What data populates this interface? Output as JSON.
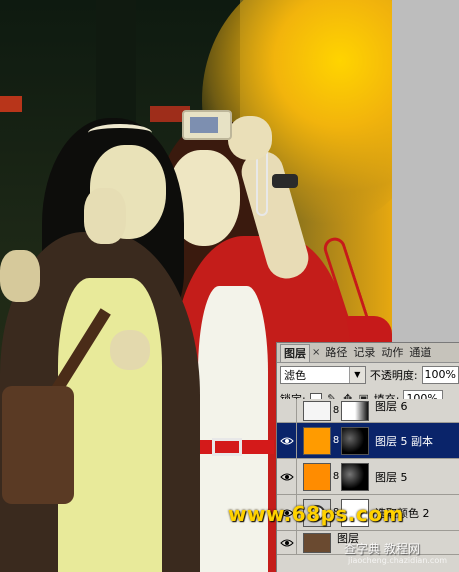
{
  "layers_panel": {
    "tabs": [
      {
        "label": "图层",
        "active": true
      },
      {
        "label": "路径",
        "active": false
      },
      {
        "label": "记录",
        "active": false
      },
      {
        "label": "动作",
        "active": false
      },
      {
        "label": "通道",
        "active": false
      }
    ],
    "tab_close": "×",
    "blend_mode": "滤色",
    "opacity_label": "不透明度:",
    "opacity_value": "100%",
    "lock_label": "锁定:",
    "fill_label": "填充:",
    "fill_value": "100%",
    "layers": [
      {
        "name": "图层 6",
        "visible": false,
        "selected": false,
        "thumb_color": "#f5f5f5",
        "mask": "white-black"
      },
      {
        "name": "图层 5 副本",
        "visible": true,
        "selected": true,
        "thumb_color": "#ff8c00",
        "mask": "black-radial"
      },
      {
        "name": "图层 5",
        "visible": true,
        "selected": false,
        "thumb_color": "#ff8c00",
        "mask": "black-radial"
      },
      {
        "name": "选取颜色 2",
        "visible": true,
        "selected": false,
        "thumb_color": "#d8d8d8",
        "mask": "white"
      },
      {
        "name": "图层",
        "visible": true,
        "selected": false,
        "thumb_color": "#6a4a30",
        "mask": "none"
      }
    ]
  },
  "watermark": {
    "site": "www.68ps.com",
    "cn_text": "查字典 教程网",
    "cn_url": "jiaocheng.chazidian.com"
  }
}
